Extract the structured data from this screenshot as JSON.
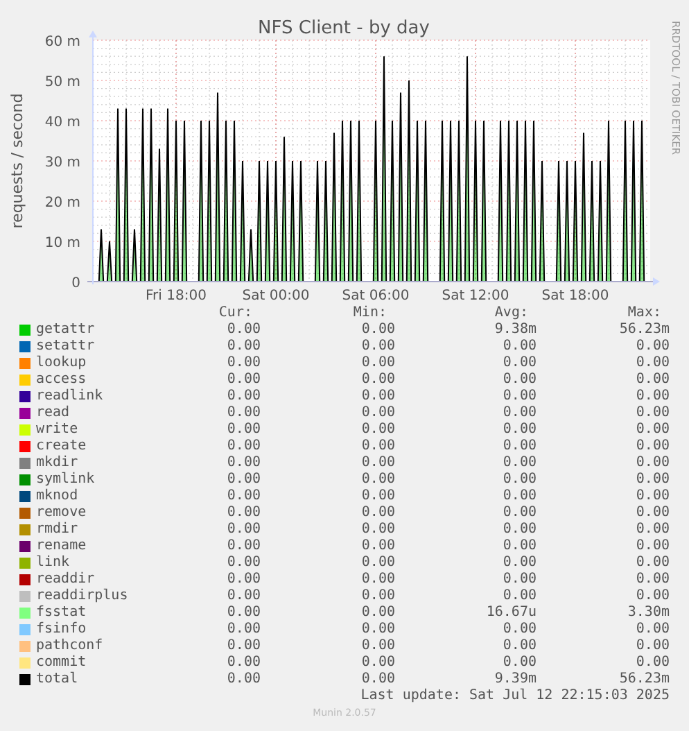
{
  "chart": {
    "title": "NFS Client - by day",
    "credit": "RRDTOOL / TOBI OETIKER",
    "chart_data": {
      "type": "area",
      "grid": true,
      "ylabel": "requests / second",
      "ylim": [
        0,
        60
      ],
      "yticks": [
        {
          "value": 0,
          "label": "0"
        },
        {
          "value": 10,
          "label": "10 m"
        },
        {
          "value": 20,
          "label": "20 m"
        },
        {
          "value": 30,
          "label": "30 m"
        },
        {
          "value": 40,
          "label": "40 m"
        },
        {
          "value": 50,
          "label": "50 m"
        },
        {
          "value": 60,
          "label": "60 m"
        }
      ],
      "categories": [
        null,
        null,
        null,
        null,
        null,
        null,
        null,
        null,
        null,
        null,
        "Fri 18:00",
        null,
        null,
        null,
        null,
        null,
        null,
        null,
        null,
        null,
        null,
        null,
        "Sat 00:00",
        null,
        null,
        null,
        null,
        null,
        null,
        null,
        null,
        null,
        null,
        null,
        "Sat 06:00",
        null,
        null,
        null,
        null,
        null,
        null,
        null,
        null,
        null,
        null,
        null,
        "Sat 12:00",
        null,
        null,
        null,
        null,
        null,
        null,
        null,
        null,
        null,
        null,
        null,
        "Sat 18:00",
        null,
        null,
        null,
        null,
        null,
        null,
        null,
        null
      ],
      "series": [
        {
          "color": "#00cc00",
          "values": [
            null,
            13,
            10,
            43,
            43,
            13,
            43,
            43,
            33,
            43,
            40,
            40,
            null,
            40,
            40,
            47,
            40,
            40,
            30,
            13,
            30,
            30,
            30,
            36,
            30,
            30,
            null,
            30,
            30,
            37,
            40,
            40,
            40,
            null,
            40,
            56,
            40,
            47,
            50,
            40,
            40,
            null,
            40,
            40,
            40,
            56,
            40,
            40,
            null,
            40,
            40,
            40,
            40,
            40,
            30,
            null,
            30,
            30,
            30,
            37,
            30,
            30,
            40,
            null,
            40,
            40,
            40
          ]
        }
      ]
    }
  },
  "legend": {
    "columns": [
      "Cur:",
      "Min:",
      "Avg:",
      "Max:"
    ],
    "rows": [
      {
        "name": "getattr",
        "color": "#00cc00",
        "cur": "0.00",
        "min": "0.00",
        "avg": "9.38m",
        "max": "56.23m"
      },
      {
        "name": "setattr",
        "color": "#0066b3",
        "cur": "0.00",
        "min": "0.00",
        "avg": "0.00",
        "max": "0.00"
      },
      {
        "name": "lookup",
        "color": "#ff8000",
        "cur": "0.00",
        "min": "0.00",
        "avg": "0.00",
        "max": "0.00"
      },
      {
        "name": "access",
        "color": "#ffcc00",
        "cur": "0.00",
        "min": "0.00",
        "avg": "0.00",
        "max": "0.00"
      },
      {
        "name": "readlink",
        "color": "#330099",
        "cur": "0.00",
        "min": "0.00",
        "avg": "0.00",
        "max": "0.00"
      },
      {
        "name": "read",
        "color": "#990099",
        "cur": "0.00",
        "min": "0.00",
        "avg": "0.00",
        "max": "0.00"
      },
      {
        "name": "write",
        "color": "#ccff00",
        "cur": "0.00",
        "min": "0.00",
        "avg": "0.00",
        "max": "0.00"
      },
      {
        "name": "create",
        "color": "#ff0000",
        "cur": "0.00",
        "min": "0.00",
        "avg": "0.00",
        "max": "0.00"
      },
      {
        "name": "mkdir",
        "color": "#808080",
        "cur": "0.00",
        "min": "0.00",
        "avg": "0.00",
        "max": "0.00"
      },
      {
        "name": "symlink",
        "color": "#008f00",
        "cur": "0.00",
        "min": "0.00",
        "avg": "0.00",
        "max": "0.00"
      },
      {
        "name": "mknod",
        "color": "#00487d",
        "cur": "0.00",
        "min": "0.00",
        "avg": "0.00",
        "max": "0.00"
      },
      {
        "name": "remove",
        "color": "#b35a00",
        "cur": "0.00",
        "min": "0.00",
        "avg": "0.00",
        "max": "0.00"
      },
      {
        "name": "rmdir",
        "color": "#b38f00",
        "cur": "0.00",
        "min": "0.00",
        "avg": "0.00",
        "max": "0.00"
      },
      {
        "name": "rename",
        "color": "#6b006b",
        "cur": "0.00",
        "min": "0.00",
        "avg": "0.00",
        "max": "0.00"
      },
      {
        "name": "link",
        "color": "#8fb300",
        "cur": "0.00",
        "min": "0.00",
        "avg": "0.00",
        "max": "0.00"
      },
      {
        "name": "readdir",
        "color": "#b30000",
        "cur": "0.00",
        "min": "0.00",
        "avg": "0.00",
        "max": "0.00"
      },
      {
        "name": "readdirplus",
        "color": "#bebebe",
        "cur": "0.00",
        "min": "0.00",
        "avg": "0.00",
        "max": "0.00"
      },
      {
        "name": "fsstat",
        "color": "#80ff80",
        "cur": "0.00",
        "min": "0.00",
        "avg": "16.67u",
        "max": "3.30m"
      },
      {
        "name": "fsinfo",
        "color": "#80c9ff",
        "cur": "0.00",
        "min": "0.00",
        "avg": "0.00",
        "max": "0.00"
      },
      {
        "name": "pathconf",
        "color": "#ffc080",
        "cur": "0.00",
        "min": "0.00",
        "avg": "0.00",
        "max": "0.00"
      },
      {
        "name": "commit",
        "color": "#ffe680",
        "cur": "0.00",
        "min": "0.00",
        "avg": "0.00",
        "max": "0.00"
      },
      {
        "name": "total",
        "color": "#000000",
        "cur": "0.00",
        "min": "0.00",
        "avg": "9.39m",
        "max": "56.23m"
      }
    ]
  },
  "last_update": "Last update: Sat Jul 12 22:15:03 2025",
  "footer": "Munin 2.0.57"
}
